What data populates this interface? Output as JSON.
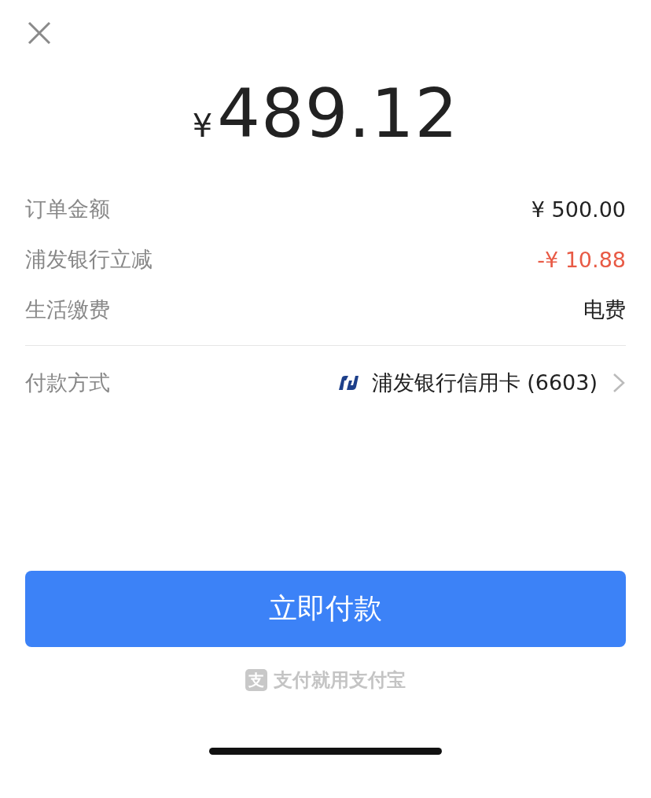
{
  "amount": {
    "currency": "¥",
    "value": "489.12"
  },
  "details": [
    {
      "label": "订单金额",
      "value": "¥ 500.00",
      "kind": "normal"
    },
    {
      "label": "浦发银行立减",
      "value": "-¥ 10.88",
      "kind": "discount"
    },
    {
      "label": "生活缴费",
      "value": "电费",
      "kind": "normal"
    }
  ],
  "payment_method": {
    "label": "付款方式",
    "value": "浦发银行信用卡 (6603)"
  },
  "pay_button": {
    "label": "立即付款"
  },
  "footer": {
    "logo_char": "支",
    "slogan": "支付就用支付宝"
  }
}
